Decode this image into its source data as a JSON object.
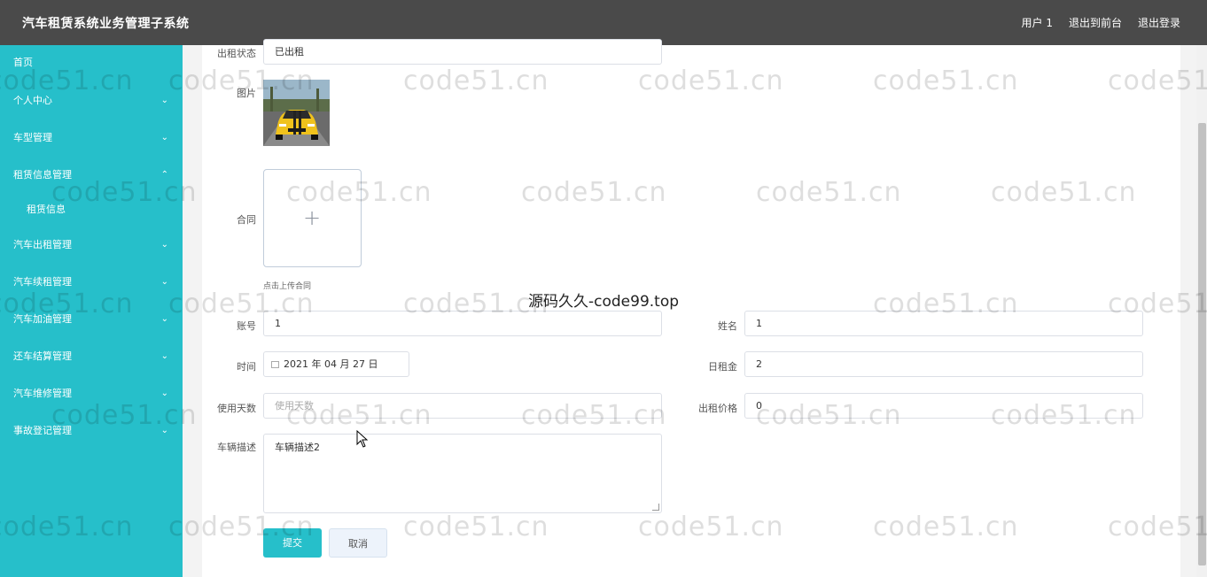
{
  "header": {
    "title": "汽车租赁系统业务管理子系统",
    "nav": [
      "用户 1",
      "退出到前台",
      "退出登录"
    ]
  },
  "sidebar": {
    "items": [
      {
        "label": "首页",
        "chevron": ""
      },
      {
        "label": "个人中心",
        "chevron": "⌄"
      },
      {
        "label": "车型管理",
        "chevron": "⌄"
      },
      {
        "label": "租赁信息管理",
        "chevron": "⌃"
      },
      {
        "label": "租赁信息",
        "chevron": ""
      },
      {
        "label": "汽车出租管理",
        "chevron": "⌄"
      },
      {
        "label": "汽车续租管理",
        "chevron": "⌄"
      },
      {
        "label": "汽车加油管理",
        "chevron": "⌄"
      },
      {
        "label": "还车结算管理",
        "chevron": "⌄"
      },
      {
        "label": "汽车维修管理",
        "chevron": "⌄"
      },
      {
        "label": "事故登记管理",
        "chevron": "⌄"
      }
    ]
  },
  "form": {
    "status_label": "出租状态",
    "status_value": "已出租",
    "image_label": "图片",
    "contract_label": "合同",
    "upload_plus": "+",
    "upload_tip": "点击上传合同",
    "account_label": "账号",
    "account_value": "1",
    "name_label": "姓名",
    "name_value": "1",
    "time_label": "时间",
    "time_value": "2021 年 04 月 27 日",
    "daily_rent_label": "日租金",
    "daily_rent_value": "2",
    "days_label": "使用天数",
    "days_placeholder": "使用天数",
    "price_label": "出租价格",
    "price_value": "0",
    "desc_label": "车辆描述",
    "desc_value": "车辆描述2",
    "submit_label": "提交",
    "cancel_label": "取消"
  },
  "watermarks": {
    "repeat": "code51.cn",
    "center": "源码久久-code99.top"
  },
  "colors": {
    "header_bg": "#4a4a4a",
    "sidebar_bg": "#26bfca",
    "primary": "#26bfca"
  }
}
